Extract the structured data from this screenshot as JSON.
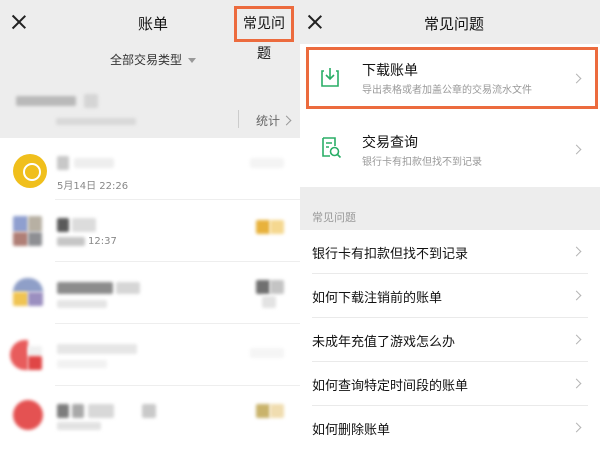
{
  "left": {
    "title": "账单",
    "faq_button": "常见问题",
    "filter": "全部交易类型",
    "stat": "统计",
    "tx_date": "5月14日 22:26",
    "tx_date_2": "12:37",
    "colors": {
      "coin": "#f0bf1c",
      "highlight": "#ec6b3e"
    }
  },
  "right": {
    "title": "常见问题",
    "tools": [
      {
        "title": "下载账单",
        "sub": "导出表格或者加盖公章的交易流水文件",
        "icon": "download-icon"
      },
      {
        "title": "交易查询",
        "sub": "银行卡有扣款但找不到记录",
        "icon": "search-document-icon"
      }
    ],
    "section_label": "常见问题",
    "questions": [
      "银行卡有扣款但找不到记录",
      "如何下载注销前的账单",
      "未成年充值了游戏怎么办",
      "如何查询特定时间段的账单",
      "如何删除账单"
    ]
  }
}
